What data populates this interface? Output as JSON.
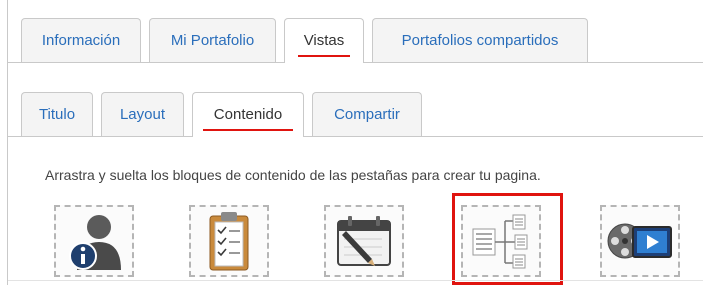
{
  "main_tabs": [
    {
      "label": "Información"
    },
    {
      "label": "Mi Portafolio"
    },
    {
      "label": "Vistas"
    },
    {
      "label": "Portafolios compartidos"
    }
  ],
  "sub_tabs": [
    {
      "label": "Titulo"
    },
    {
      "label": "Layout"
    },
    {
      "label": "Contenido"
    },
    {
      "label": "Compartir"
    }
  ],
  "instructions": "Arrastra y suelta los bloques de contenido de las pestañas para crear tu pagina.",
  "blocks": [
    {
      "icon": "profile-info-icon"
    },
    {
      "icon": "clipboard-checklist-icon"
    },
    {
      "icon": "calendar-pencil-icon"
    },
    {
      "icon": "tree-documents-icon"
    },
    {
      "icon": "film-reel-video-icon"
    }
  ],
  "colors": {
    "link": "#2a6ebb",
    "accent_red": "#e0140f",
    "border": "#c9c9c9"
  }
}
